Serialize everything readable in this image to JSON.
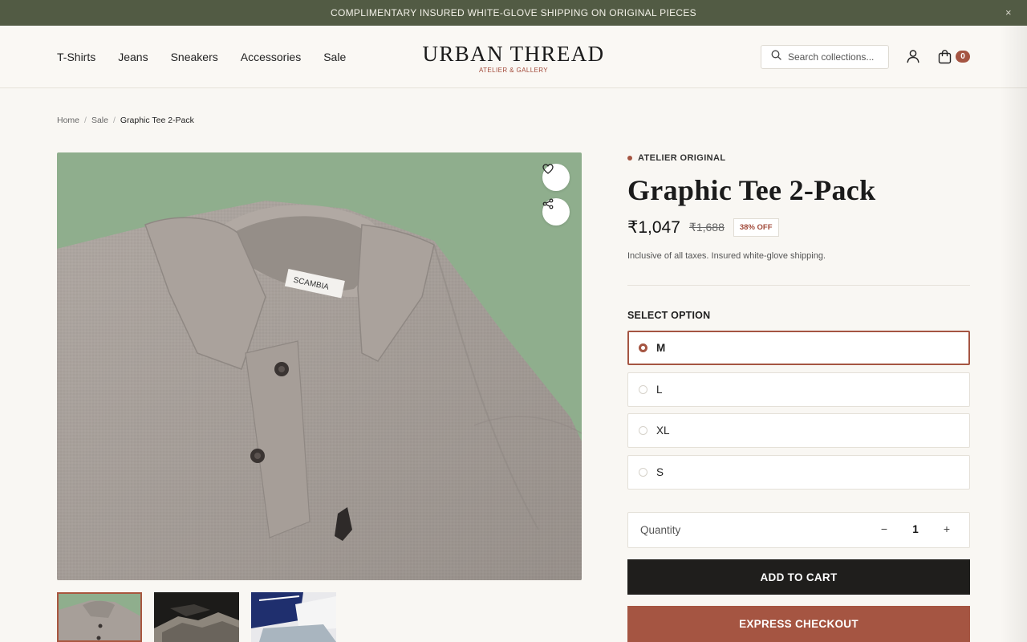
{
  "announcement": {
    "text": "COMPLIMENTARY INSURED WHITE-GLOVE SHIPPING ON ORIGINAL PIECES",
    "close": "×"
  },
  "nav": {
    "items": [
      "T-Shirts",
      "Jeans",
      "Sneakers",
      "Accessories",
      "Sale"
    ]
  },
  "brand": {
    "name": "URBAN THREAD",
    "tagline": "ATELIER & GALLERY"
  },
  "search": {
    "placeholder": "Search collections..."
  },
  "cart": {
    "count": "0"
  },
  "breadcrumb": {
    "items": [
      "Home",
      "Sale",
      "Graphic Tee 2-Pack"
    ],
    "separator": "/"
  },
  "product": {
    "eyebrow": "ATELIER ORIGINAL",
    "title": "Graphic Tee 2-Pack",
    "price": "₹1,047",
    "compare_price": "₹1,688",
    "discount": "38% OFF",
    "tax_note": "Inclusive of all taxes. Insured white-glove shipping.",
    "collar_label": "SCAMBIA"
  },
  "options": {
    "heading": "SELECT OPTION",
    "items": [
      "M",
      "L",
      "XL",
      "S"
    ],
    "selected": "M"
  },
  "quantity": {
    "label": "Quantity",
    "value": "1",
    "minus": "−",
    "plus": "+"
  },
  "actions": {
    "add_to_cart": "ADD TO CART",
    "express_checkout": "EXPRESS CHECKOUT"
  },
  "icons": {
    "search": "search-icon",
    "account": "user-icon",
    "cart": "bag-icon",
    "wishlist": "heart-icon",
    "share": "share-icon",
    "close": "close-icon"
  },
  "colors": {
    "announcement_bg": "#525b44",
    "accent": "#a55542",
    "gallery_bg": "#8fae8d",
    "cart_button": "#1f1e1c",
    "page_bg": "#f9f7f3"
  }
}
